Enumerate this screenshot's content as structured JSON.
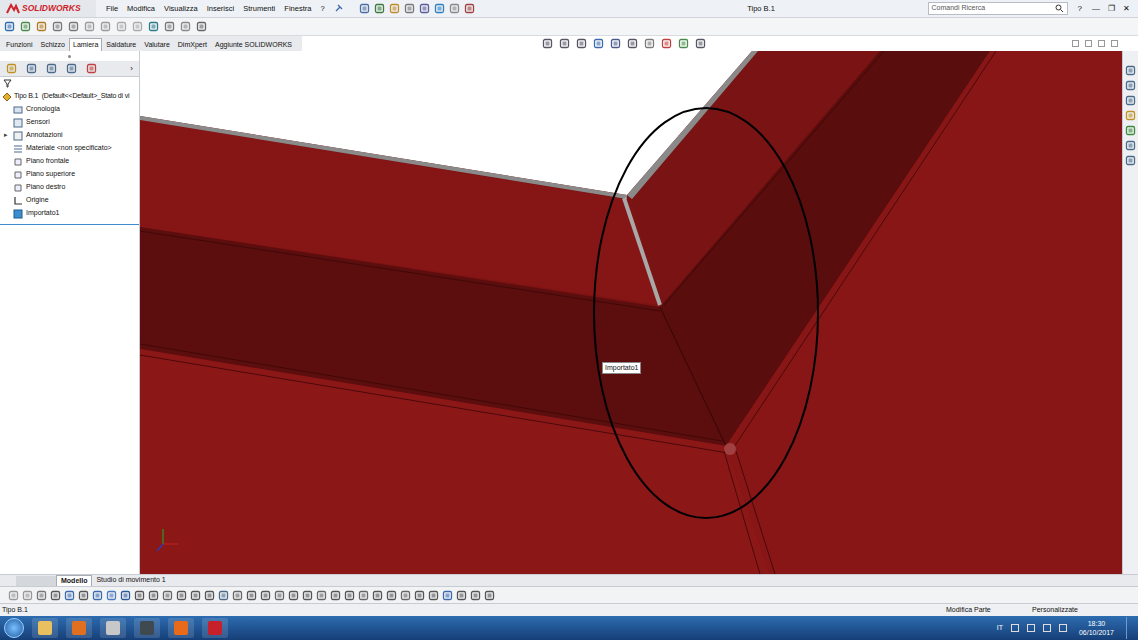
{
  "app": {
    "logo": "SOLIDWORKS",
    "title": "Tipo B.1",
    "search_placeholder": "Comandi Ricerca",
    "help": "?",
    "window_controls": [
      "—",
      "❐",
      "✕"
    ]
  },
  "menu": [
    "File",
    "Modifica",
    "Visualizza",
    "Inserisci",
    "Strumenti",
    "Finestra",
    "?"
  ],
  "command_tabs": [
    {
      "label": "Funzioni",
      "selected": false
    },
    {
      "label": "Schizzo",
      "selected": false
    },
    {
      "label": "Lamiera",
      "selected": true
    },
    {
      "label": "Saldature",
      "selected": false
    },
    {
      "label": "Valutare",
      "selected": false
    },
    {
      "label": "DimXpert",
      "selected": false
    },
    {
      "label": "Aggiunte SOLIDWORKS",
      "selected": false
    }
  ],
  "tree": {
    "root": "Tipo B.1  (Default<<Default>_Stato di vi",
    "expand_glyph": "▸",
    "items": [
      {
        "label": "Cronologia",
        "expandable": false
      },
      {
        "label": "Sensori",
        "expandable": false
      },
      {
        "label": "Annotazioni",
        "expandable": true
      },
      {
        "label": "Materiale <non specificato>",
        "expandable": false
      },
      {
        "label": "Piano frontale",
        "expandable": false
      },
      {
        "label": "Piano superiore",
        "expandable": false
      },
      {
        "label": "Piano destro",
        "expandable": false
      },
      {
        "label": "Origine",
        "expandable": false
      },
      {
        "label": "Importato1",
        "expandable": false
      }
    ]
  },
  "tooltip": "Importato1",
  "bottom_tabs": [
    {
      "label": "Modello",
      "selected": true
    },
    {
      "label": "Studio di movimento 1",
      "selected": false
    }
  ],
  "status_bar": {
    "left": "Tipo B.1",
    "mode": "Modifica Parte",
    "units": "Personalizzate"
  },
  "taskbar": {
    "language": "IT",
    "time": "18:30",
    "date": "06/10/2017"
  }
}
